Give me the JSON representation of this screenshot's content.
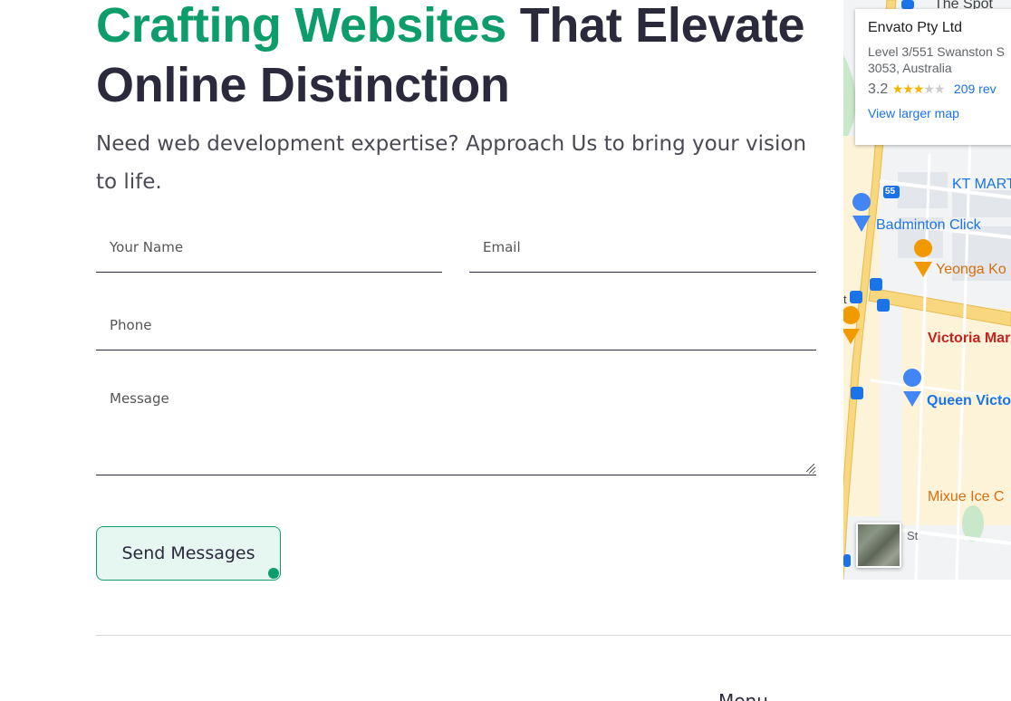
{
  "hero": {
    "headline_accent": "Crafting Websites",
    "headline_rest": "That Elevate",
    "headline_line2": "Online Distinction",
    "subtext": "Need web development expertise? Approach Us to bring your vision to life."
  },
  "form": {
    "name_placeholder": "Your Name",
    "email_placeholder": "Email",
    "phone_placeholder": "Phone",
    "message_placeholder": "Message",
    "send_label": "Send Messages"
  },
  "map": {
    "place_name": "Envato Pty Ltd",
    "address_line1": "Level 3/551 Swanston S",
    "address_line2": "3053, Australia",
    "rating": "3.2",
    "rating_stars": 3.2,
    "reviews": "209 rev",
    "larger_map": "View larger map",
    "labels": {
      "spot": "The Spot",
      "kt_mart": "KT MART",
      "badminton": "Badminton Click",
      "yeonga": "Yeonga Ko",
      "victoria_mar": "Victoria Mar",
      "queen_vic": "Queen Victo",
      "mixue": "Mixue Ice C",
      "st": "St",
      "route": "55",
      "t": "t"
    }
  },
  "footer": {
    "menu_title": "Menu"
  }
}
